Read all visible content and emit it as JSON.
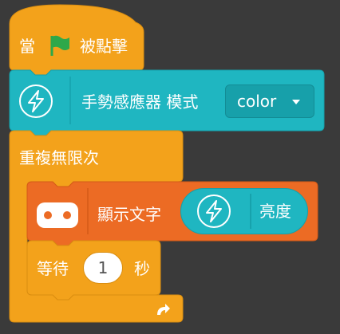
{
  "event_block": {
    "label_when": "當",
    "label_clicked": "被點擊",
    "flag_color": "#2ea84a"
  },
  "sensor_block": {
    "label": "手勢感應器 模式",
    "dropdown_value": "color",
    "color": "#1fb6c1"
  },
  "loop_block": {
    "label": "重複無限次",
    "color": "#f3a21b"
  },
  "display_block": {
    "label": "顯示文字",
    "reporter_label": "亮度",
    "color": "#ec6b24"
  },
  "wait_block": {
    "label_wait": "等待",
    "value": "1",
    "label_unit": "秒"
  }
}
